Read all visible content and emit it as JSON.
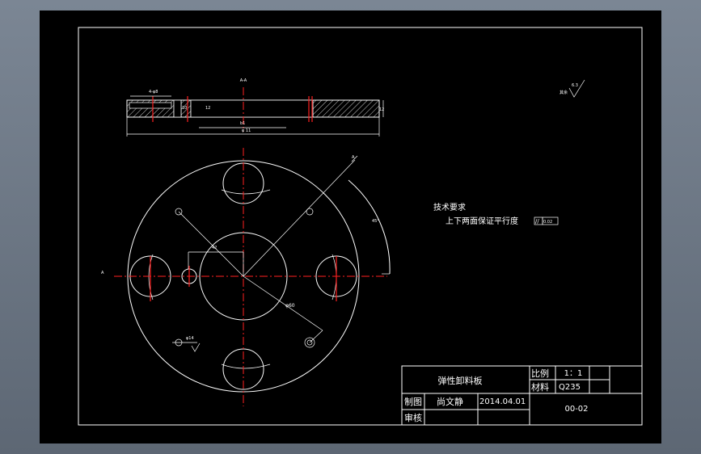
{
  "technical_requirements": {
    "heading": "技术要求",
    "line1": "上下两面保证平行度",
    "tolerance_symbol": "//",
    "tolerance_value": "0.02"
  },
  "title_block": {
    "part_name": "弹性卸料板",
    "scale_label": "比例",
    "scale_value": "1：1",
    "material_label": "材料",
    "material_value": "Q235",
    "drawn_label": "制图",
    "drawn_by": "尚文静",
    "date": "2014.04.01",
    "check_label": "审核",
    "drawing_number": "00-02"
  },
  "dimensions": {
    "top_center": "A-A",
    "phi_small": "4-φ8",
    "b1": "b1",
    "b1_total": "φ 11",
    "thickness": "12",
    "radius_label": "42",
    "diameter_label": "φ60",
    "hole_label": "φ14",
    "roughness_top": "6.3",
    "angle": "45°"
  },
  "colors": {
    "background": "#000000",
    "lines": "#ffffff",
    "centerlines": "#ff2020",
    "frame": "#7b8694"
  }
}
